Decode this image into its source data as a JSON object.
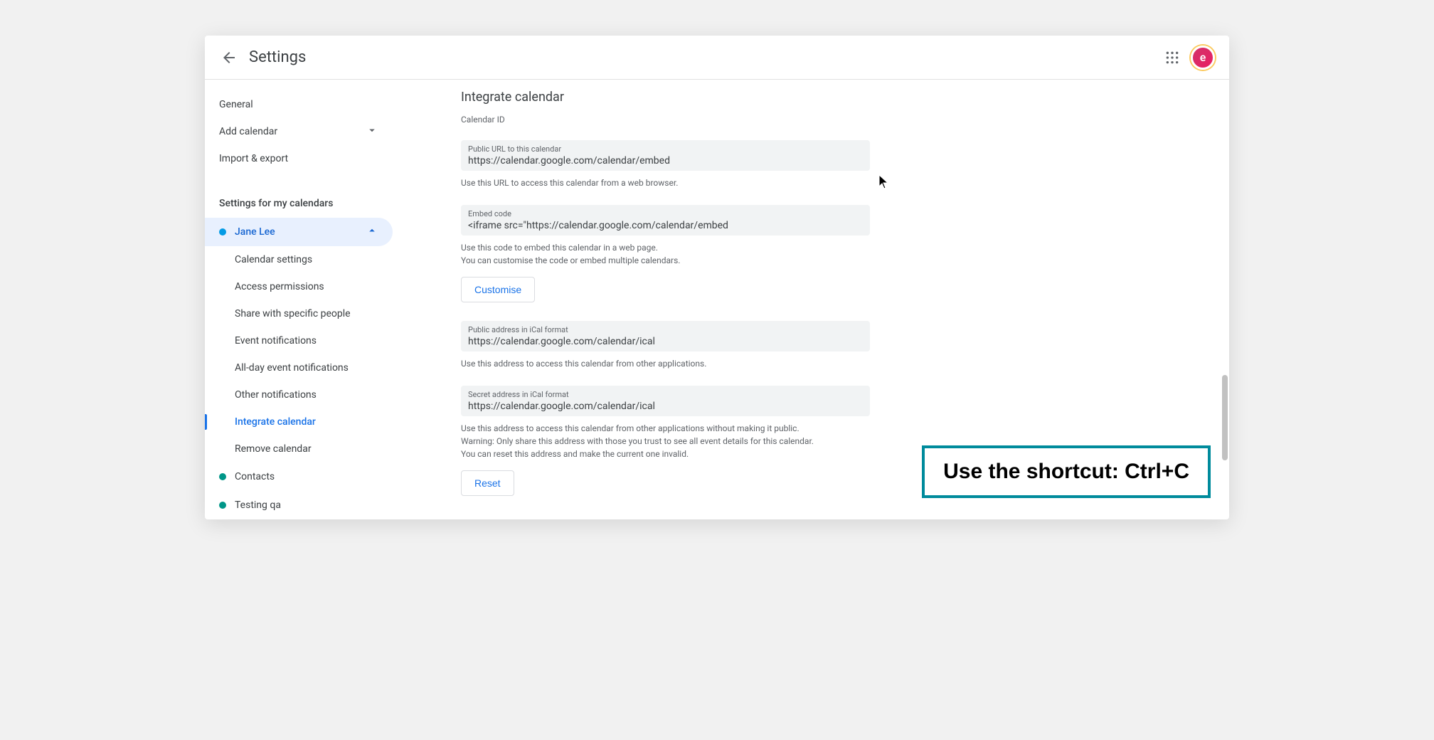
{
  "header": {
    "title": "Settings",
    "avatar_letter": "e"
  },
  "sidebar": {
    "general": "General",
    "add_calendar": "Add calendar",
    "import_export": "Import & export",
    "section_header": "Settings for my calendars",
    "calendars": {
      "jane": {
        "name": "Jane Lee",
        "color": "#039be5"
      },
      "contacts": {
        "name": "Contacts",
        "color": "#009688"
      },
      "testing": {
        "name": "Testing qa",
        "color": "#009688"
      }
    },
    "sub": {
      "calendar_settings": "Calendar settings",
      "access_permissions": "Access permissions",
      "share_specific": "Share with specific people",
      "event_notifications": "Event notifications",
      "allday_notifications": "All-day event notifications",
      "other_notifications": "Other notifications",
      "integrate": "Integrate calendar",
      "remove": "Remove calendar"
    }
  },
  "main": {
    "section_title": "Integrate calendar",
    "calendar_id_label": "Calendar ID",
    "public_url": {
      "label": "Public URL to this calendar",
      "value": "https://calendar.google.com/calendar/embed",
      "help": "Use this URL to access this calendar from a web browser."
    },
    "embed": {
      "label": "Embed code",
      "value": "<iframe src=\"https://calendar.google.com/calendar/embed",
      "help1": "Use this code to embed this calendar in a web page.",
      "help2": "You can customise the code or embed multiple calendars.",
      "button": "Customise"
    },
    "ical_public": {
      "label": "Public address in iCal format",
      "value": "https://calendar.google.com/calendar/ical",
      "help": "Use this address to access this calendar from other applications."
    },
    "ical_secret": {
      "label": "Secret address in iCal format",
      "value": "https://calendar.google.com/calendar/ical",
      "help1": "Use this address to access this calendar from other applications without making it public.",
      "help2": "Warning: Only share this address with those you trust to see all event details for this calendar.",
      "help3": "You can reset this address and make the current one invalid.",
      "button": "Reset"
    }
  },
  "overlay": {
    "tip": "Use the shortcut: Ctrl+C"
  }
}
